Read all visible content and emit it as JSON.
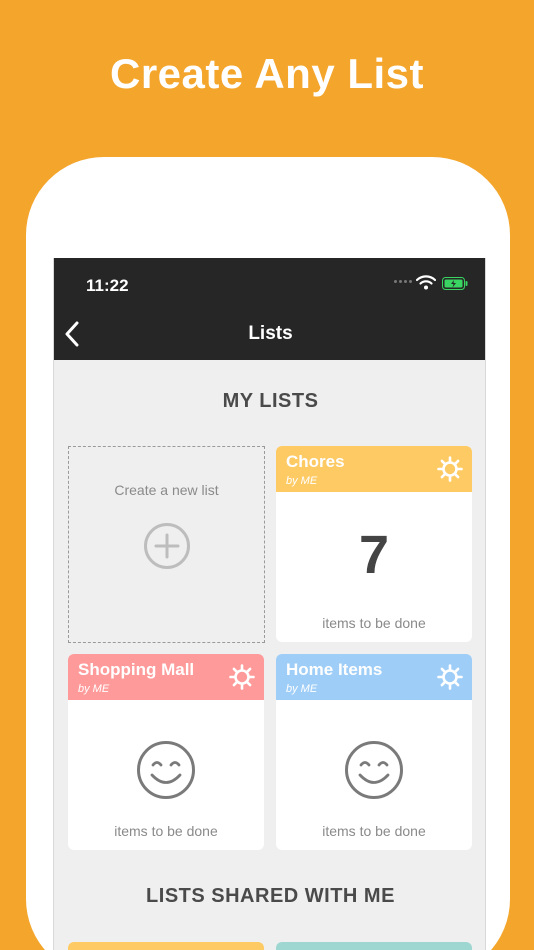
{
  "headline": "Create Any List",
  "status_bar": {
    "time": "11:22"
  },
  "nav": {
    "title": "Lists"
  },
  "my_lists": {
    "title": "MY LISTS",
    "create_label": "Create a new list",
    "cards": [
      {
        "name": "Chores",
        "owner": "by ME",
        "count": "7",
        "caption": "items to be done",
        "color": "#FDCA64"
      },
      {
        "name": "Shopping Mall",
        "owner": "by ME",
        "caption": "items to be done",
        "color": "#FF9A9A"
      },
      {
        "name": "Home Items",
        "owner": "by ME",
        "caption": "items to be done",
        "color": "#9ECDF7"
      }
    ]
  },
  "shared": {
    "title": "LISTS SHARED WITH ME",
    "colors": [
      "#FDCA64",
      "#9ED6D1"
    ]
  }
}
